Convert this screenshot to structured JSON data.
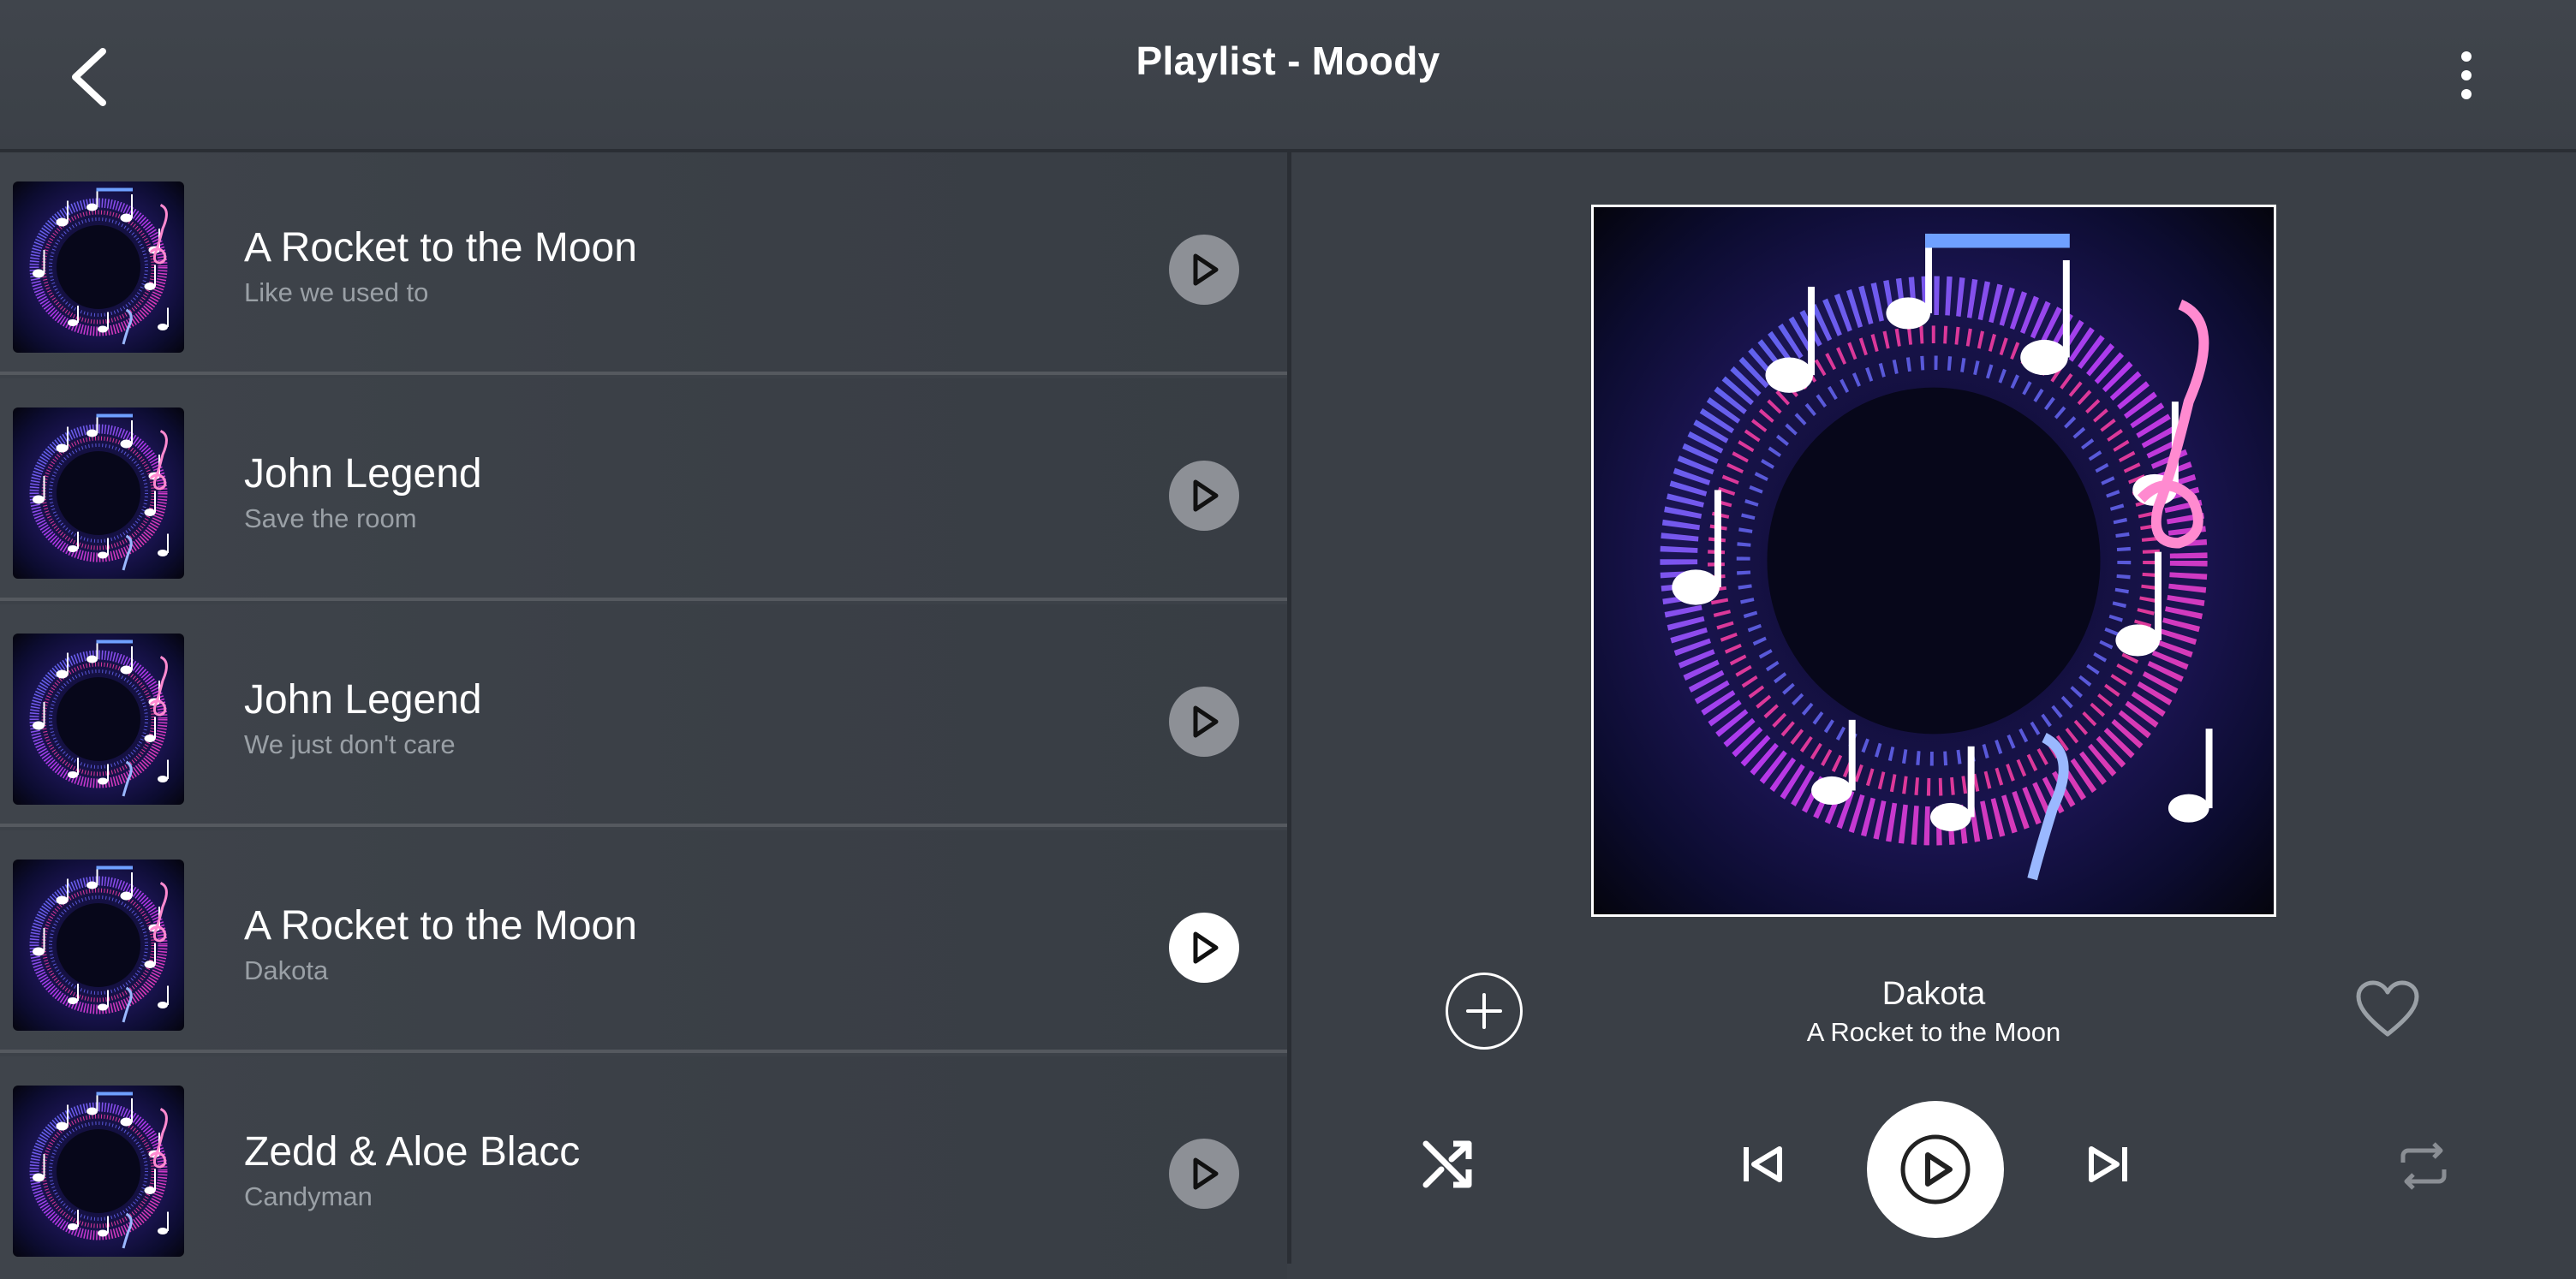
{
  "header": {
    "title": "Playlist - Moody",
    "back_icon": "chevron-left-icon",
    "menu_icon": "more-vertical-icon"
  },
  "playlist": [
    {
      "title": "A Rocket to the Moon",
      "subtitle": "Like we used to",
      "active": false
    },
    {
      "title": "John Legend",
      "subtitle": "Save the room",
      "active": false
    },
    {
      "title": "John Legend",
      "subtitle": "We just don't care",
      "active": false
    },
    {
      "title": "A Rocket to the Moon",
      "subtitle": "Dakota",
      "active": true
    },
    {
      "title": "Zedd & Aloe Blacc",
      "subtitle": "Candyman",
      "active": false
    }
  ],
  "now_playing": {
    "track": "Dakota",
    "artist": "A Rocket to the Moon",
    "icons": [
      "add-icon",
      "heart-icon",
      "shuffle-icon",
      "skip-previous-icon",
      "play-icon",
      "skip-next-icon",
      "repeat-icon"
    ]
  },
  "colors": {
    "background": "#3a3f46",
    "header": "#40454c",
    "row_play_inactive": "#8d9096",
    "row_play_active": "#ffffff",
    "subtitle": "#9aa0a6",
    "repeat_disabled": "#8a8e94"
  }
}
